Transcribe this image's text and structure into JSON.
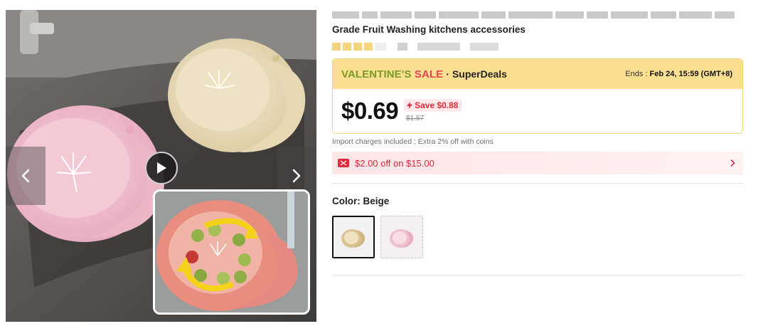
{
  "product": {
    "title_second_line": "Grade Fruit Washing kitchens accessories"
  },
  "sale": {
    "name_part1": "VALENTINE'S",
    "name_part2": "SALE",
    "separator": "·",
    "type": "SuperDeals",
    "ends_label": "Ends :",
    "ends_value": "Feb 24, 15:59 (GMT+8)",
    "banner_color": "#fcdf91"
  },
  "price": {
    "current": "$0.69",
    "save": "Save $0.88",
    "original": "$1.57"
  },
  "import_note": "Import charges included ; Extra 2% off with coins",
  "coupon": {
    "text": "$2.00 off on $15.00",
    "icon": "coupon-ticket-icon"
  },
  "color_selector": {
    "label": "Color: Beige",
    "options": [
      {
        "name": "Beige",
        "color": "#e3d2a8",
        "selected": true
      },
      {
        "name": "Pink",
        "color": "#f1c2cf",
        "selected": false
      }
    ]
  },
  "gallery": {
    "icons": [
      "chevron-left-icon",
      "chevron-right-icon",
      "play-icon"
    ]
  },
  "colors": {
    "accent_red": "#e02b3c",
    "sale_green": "#7a9b2a"
  }
}
